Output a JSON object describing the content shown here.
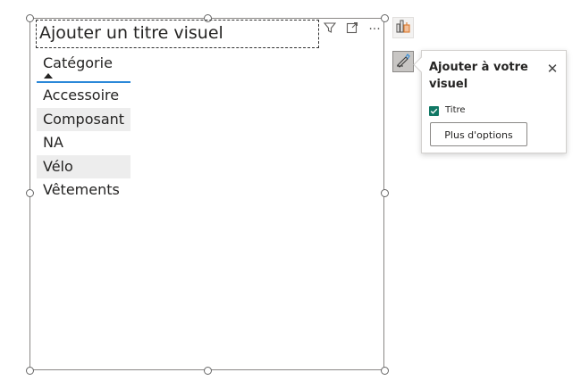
{
  "visual": {
    "title": "Ajouter un titre visuel",
    "header_icons": [
      "filter-icon",
      "focus-mode-icon",
      "more-options-icon"
    ],
    "more_label": "···"
  },
  "table": {
    "column_header": "Catégorie",
    "sort": "ascending",
    "rows": [
      "Accessoire",
      "Composant",
      "NA",
      "Vélo",
      "Vêtements"
    ]
  },
  "side_buttons": [
    "build-visual-icon",
    "format-visual-icon"
  ],
  "tooltip": {
    "title": "Ajouter à votre visuel",
    "close_label": "✕",
    "checkbox_label": "Titre",
    "checkbox_checked": true,
    "button_label": "Plus d'options"
  },
  "colors": {
    "accent_underline": "#2b88d8",
    "checkbox": "#117865",
    "row_band": "#ededed"
  }
}
